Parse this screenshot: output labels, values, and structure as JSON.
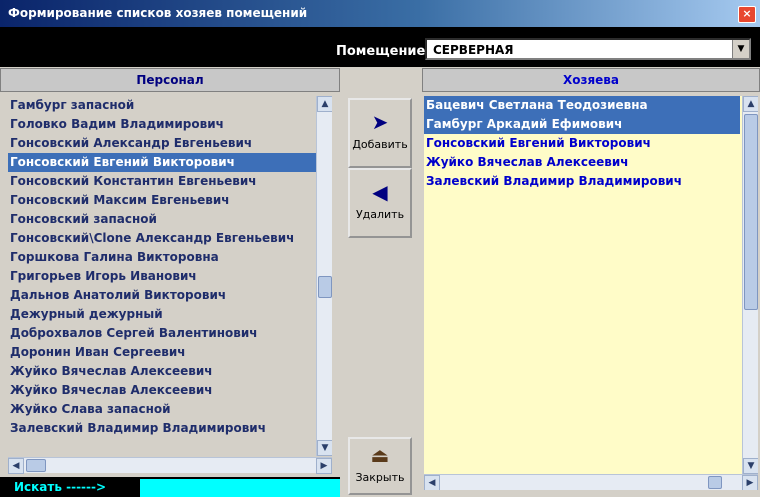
{
  "window": {
    "title": "Формирование списков хозяев помещений",
    "close_glyph": "×"
  },
  "room": {
    "label": "Помещение:",
    "value": "СЕРВЕРНАЯ",
    "dropdown_glyph": "▼"
  },
  "left": {
    "header": "Персонал",
    "items": [
      "Гамбург запасной",
      "Головко Вадим Владимирович",
      "Гонсовский Александр Евгеньевич",
      "Гонсовский Евгений Викторович",
      "Гонсовский Константин Евгеньевич",
      "Гонсовский Максим Евгеньевич",
      "Гонсовский запасной",
      "Гонсовский\\Clone Александр Евгеньевич",
      "Горшкова Галина Викторовна",
      "Григорьев Игорь Иванович",
      "Дальнов Анатолий Викторович",
      "Дежурный дежурный",
      "Доброхвалов Сергей Валентинович",
      "Доронин Иван Сергеевич",
      "Жуйко Вячеслав Алексеевич",
      "Жуйко Вячеслав Алексеевич",
      "Жуйко Слава запасной",
      "Залевский Владимир Владимирович"
    ],
    "selected_index": 3
  },
  "right": {
    "header": "Хозяева",
    "items": [
      "Бацевич Светлана Теодозиевна",
      "Гамбург Аркадий Ефимович",
      "Гонсовский Евгений Викторович",
      "Жуйко Вячеслав Алексеевич",
      "Залевский Владимир Владимирович"
    ],
    "selected_indices": [
      0,
      1
    ]
  },
  "buttons": {
    "add": {
      "label": "Добавить",
      "icon": "➤"
    },
    "remove": {
      "label": "Удалить",
      "icon": "◀"
    },
    "close": {
      "label": "Закрыть",
      "icon": "⏏"
    }
  },
  "search": {
    "label": "Искать ------>",
    "value": ""
  },
  "scroll_glyphs": {
    "up": "▲",
    "down": "▼",
    "left": "◀",
    "right": "▶"
  }
}
